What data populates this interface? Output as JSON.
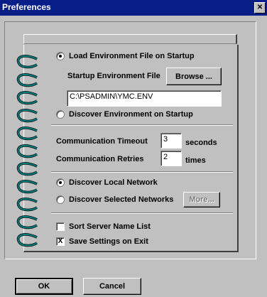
{
  "window": {
    "title": "Preferences",
    "close_glyph": "✕"
  },
  "options": {
    "load_env_label": "Load Environment File on Startup",
    "startup_env_file_label": "Startup Environment File",
    "browse_label": "Browse ...",
    "env_file_path": "C:\\PSADMIN\\YMC.ENV",
    "discover_env_label": "Discover Environment on Startup",
    "comm_timeout_label": "Communication Timeout",
    "comm_timeout_value": "3",
    "comm_timeout_unit": "seconds",
    "comm_retries_label": "Communication Retries",
    "comm_retries_value": "2",
    "comm_retries_unit": "times",
    "discover_local_label": "Discover Local Network",
    "discover_selected_label": "Discover Selected Networks",
    "more_label": "More...",
    "sort_server_label": "Sort Server Name List",
    "save_settings_label": "Save Settings on Exit",
    "check_mark": "X"
  },
  "footer": {
    "ok_label": "OK",
    "cancel_label": "Cancel"
  },
  "colors": {
    "titlebar": "#0a1e8a",
    "face": "#c0c0c0",
    "binder_ring": "#008080"
  },
  "icons": {
    "binder_ring": "binder-ring-icon",
    "close": "close-icon"
  }
}
